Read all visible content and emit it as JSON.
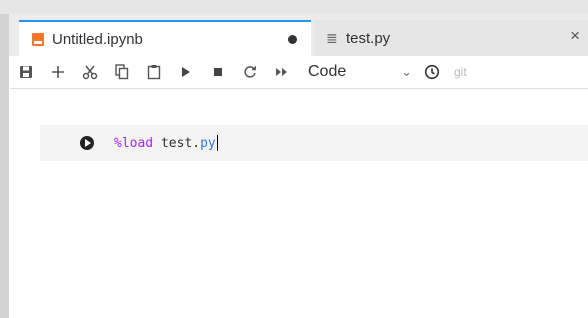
{
  "tabs": [
    {
      "label": "Untitled.ipynb",
      "icon": "notebook-icon",
      "state": "unsaved"
    },
    {
      "label": "test.py",
      "icon": "text-file-icon",
      "close": "×"
    }
  ],
  "toolbar": {
    "buttons": [
      "save-icon",
      "add-cell-icon",
      "cut-icon",
      "copy-icon",
      "paste-icon",
      "run-icon",
      "stop-icon",
      "restart-icon",
      "run-all-icon"
    ],
    "cell_type": "Code",
    "git_label": "git"
  },
  "cell": {
    "magic": "%load",
    "text": " test.",
    "ext": "py"
  },
  "colors": {
    "accent": "#2196f3",
    "notebook_icon": "#f37726",
    "magic": "#aa22ff",
    "extension": "#2e7bd6"
  }
}
